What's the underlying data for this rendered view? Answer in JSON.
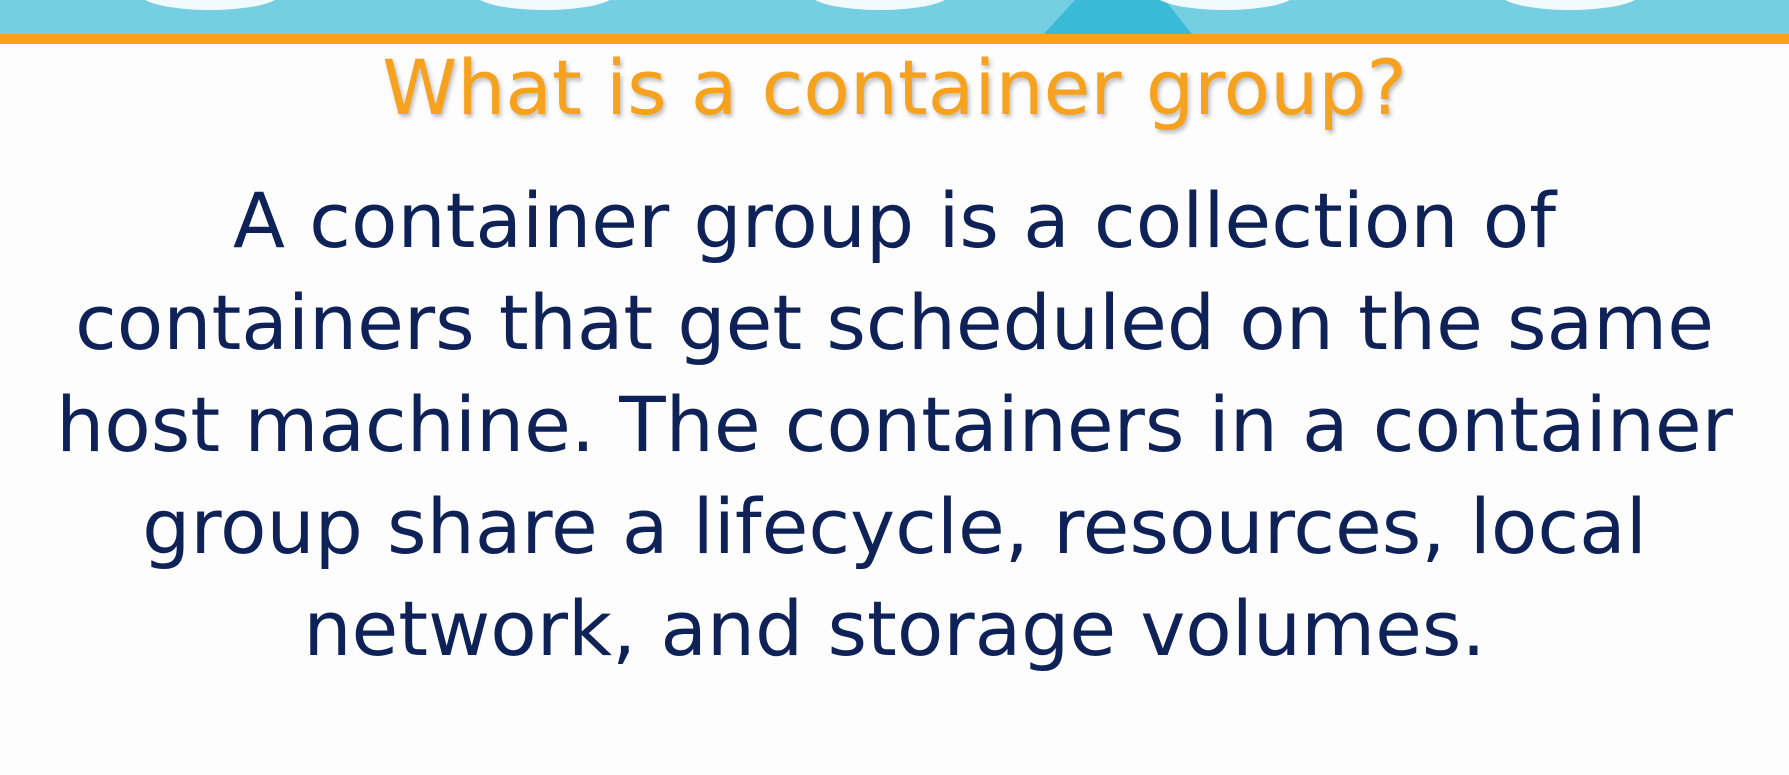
{
  "colors": {
    "banner_light": "#74cfe3",
    "banner_dark": "#3bbad8",
    "banner_stripe": "#f6a21e",
    "title": "#f6a21e",
    "body_text": "#0f2258",
    "background": "#fdfdfd"
  },
  "slide": {
    "title": "What is a container group?",
    "body_lines": [
      "A container group is a collection of",
      "containers that get scheduled on the same",
      "host machine. The containers in a container",
      "group share a lifecycle, resources, local",
      "network, and storage volumes."
    ]
  }
}
